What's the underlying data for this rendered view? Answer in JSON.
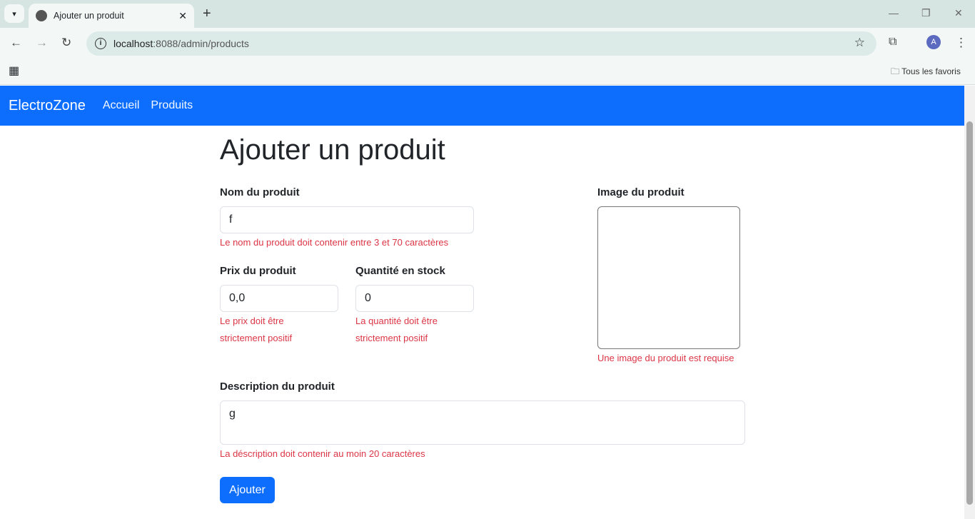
{
  "browser": {
    "tab_title": "Ajouter un produit",
    "url_host": "localhost",
    "url_path": ":8088/admin/products",
    "bookmarks_label": "Tous les favoris",
    "profile_initial": "A"
  },
  "nav": {
    "brand": "ElectroZone",
    "links": [
      "Accueil",
      "Produits"
    ]
  },
  "page": {
    "title": "Ajouter un produit",
    "name": {
      "label": "Nom du produit",
      "value": "f",
      "error": "Le nom du produit doit contenir entre 3 et 70 caractères"
    },
    "price": {
      "label": "Prix du produit",
      "value": "0,0",
      "error": "Le prix doit être strictement positif"
    },
    "qty": {
      "label": "Quantité en stock",
      "value": "0",
      "error": "La quantité doit être strictement positif"
    },
    "image": {
      "label": "Image du produit",
      "error": "Une image du produit est requise"
    },
    "desc": {
      "label": "Description du produit",
      "value": "g",
      "error": "La déscription doit contenir au moin 20 caractères"
    },
    "submit": "Ajouter"
  },
  "colors": {
    "primary": "#0d6efd",
    "error": "#dc3545"
  }
}
